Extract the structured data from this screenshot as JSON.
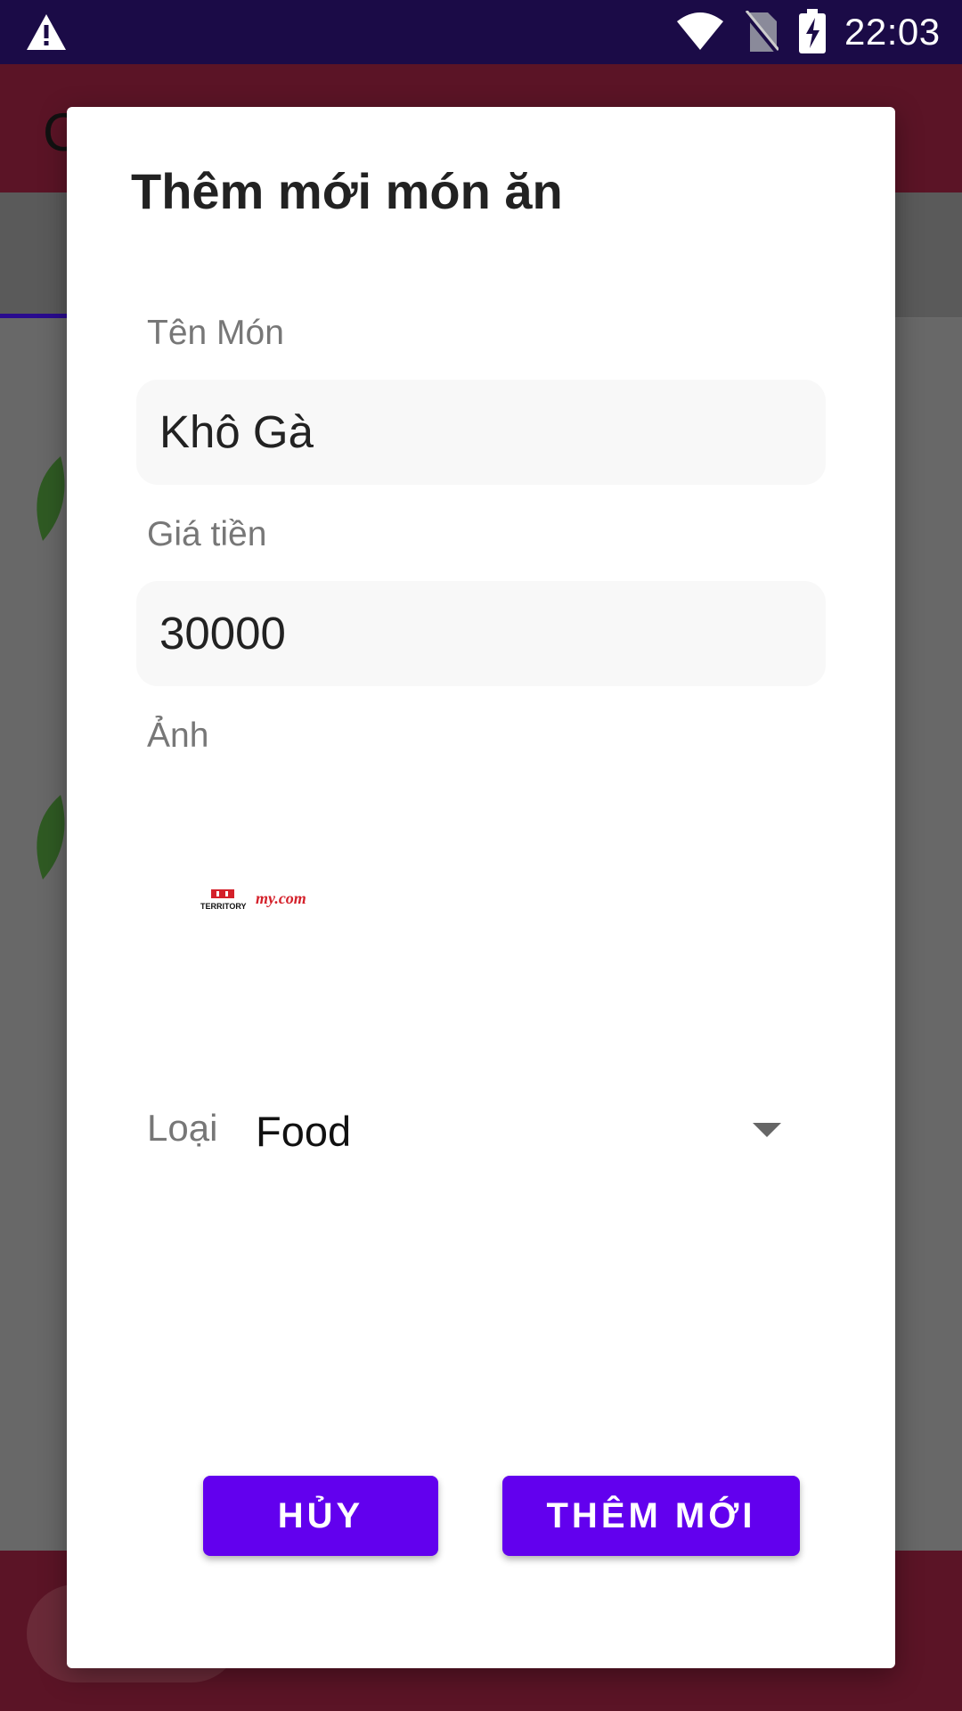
{
  "status_bar": {
    "time": "22:03",
    "icons": [
      "warning-icon",
      "wifi-icon",
      "no-sim-icon",
      "battery-charging-icon"
    ]
  },
  "background": {
    "app_bar_title_fragment": "C"
  },
  "dialog": {
    "title": "Thêm mới món ăn",
    "name_label": "Tên Món",
    "name_value": "Khô Gà",
    "price_label": "Giá tiền",
    "price_value": "30000",
    "image_label": "Ảnh",
    "image_logo_text_left": "TERRITORY",
    "image_logo_text_right": "my.com",
    "type_label": "Loại",
    "type_value": "Food",
    "cancel_label": "HỦY",
    "add_label": "THÊM MỚI"
  },
  "colors": {
    "status_bar": "#1b0b47",
    "accent": "#6200ee",
    "app_bar": "#5b1426"
  }
}
